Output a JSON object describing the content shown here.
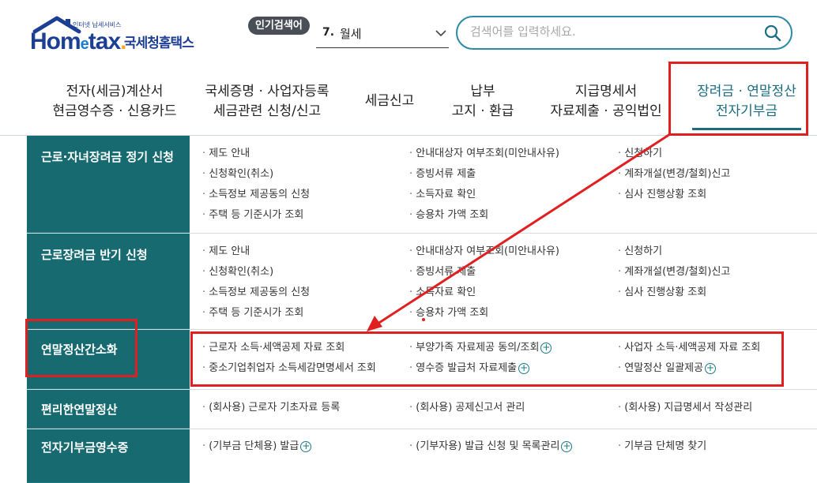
{
  "logo": {
    "brand": "Hom",
    "brand_e": "e",
    "brand_tail": "tax",
    "name": "국세청홈택스",
    "sub": "인터넷 납세서비스"
  },
  "popular": {
    "label": "인기검색어",
    "rank": "7.",
    "keyword": "월세"
  },
  "search": {
    "placeholder": "검색어를 입력하세요."
  },
  "nav": [
    {
      "line1": "전자(세금)계산서",
      "line2": "현금영수증 · 신용카드"
    },
    {
      "line1": "국세증명 · 사업자등록",
      "line2": "세금관련 신청/신고"
    },
    {
      "line1": "세금신고",
      "line2": ""
    },
    {
      "line1": "납부",
      "line2": "고지 · 환급"
    },
    {
      "line1": "지급명세서",
      "line2": "자료제출 · 공익법인"
    },
    {
      "line1": "장려금 · 연말정산",
      "line2": "전자기부금"
    }
  ],
  "menu": [
    {
      "title": "근로·자녀장려금 정기 신청",
      "col1": [
        "제도 안내",
        "신청확인(취소)",
        "소득정보 제공동의 신청",
        "주택 등 기준시가 조회"
      ],
      "col2": [
        "안내대상자 여부조회(미안내사유)",
        "증빙서류 제출",
        "소득자료 확인",
        "승용차 가액 조회"
      ],
      "col3": [
        "신청하기",
        "계좌개설(변경/철회)신고",
        "심사 진행상황 조회"
      ]
    },
    {
      "title": "근로장려금 반기 신청",
      "col1": [
        "제도 안내",
        "신청확인(취소)",
        "소득정보 제공동의 신청",
        "주택 등 기준시가 조회"
      ],
      "col2": [
        "안내대상자 여부조회(미안내사유)",
        "증빙서류 제출",
        "소득자료 확인",
        "승용차 가액 조회"
      ],
      "col3": [
        "신청하기",
        "계좌개설(변경/철회)신고",
        "심사 진행상황 조회"
      ]
    },
    {
      "title": "연말정산간소화",
      "col1": [
        "근로자 소득·세액공제 자료 조회",
        "중소기업취업자 소득세감면명세서 조회"
      ],
      "col2": [
        "부양가족 자료제공 동의/조회",
        "영수증 발급처 자료제출"
      ],
      "col3": [
        "사업자 소득·세액공제 자료 조회",
        "연말정산 일괄제공"
      ]
    },
    {
      "title": "편리한연말정산",
      "col1": [
        "(회사용) 근로자 기초자료 등록"
      ],
      "col2": [
        "(회사용) 공제신고서 관리"
      ],
      "col3": [
        "(회사용) 지급명세서 작성관리"
      ]
    },
    {
      "title": "전자기부금영수증",
      "col1": [
        "(기부금 단체용) 발급"
      ],
      "col2": [
        "(기부자용) 발급 신청 및 목록관리"
      ],
      "col3": [
        "기부금 단체명 찾기"
      ]
    }
  ],
  "colors": {
    "accent": "#166a70",
    "annotation": "#e02020",
    "brand": "#1c3f94"
  }
}
